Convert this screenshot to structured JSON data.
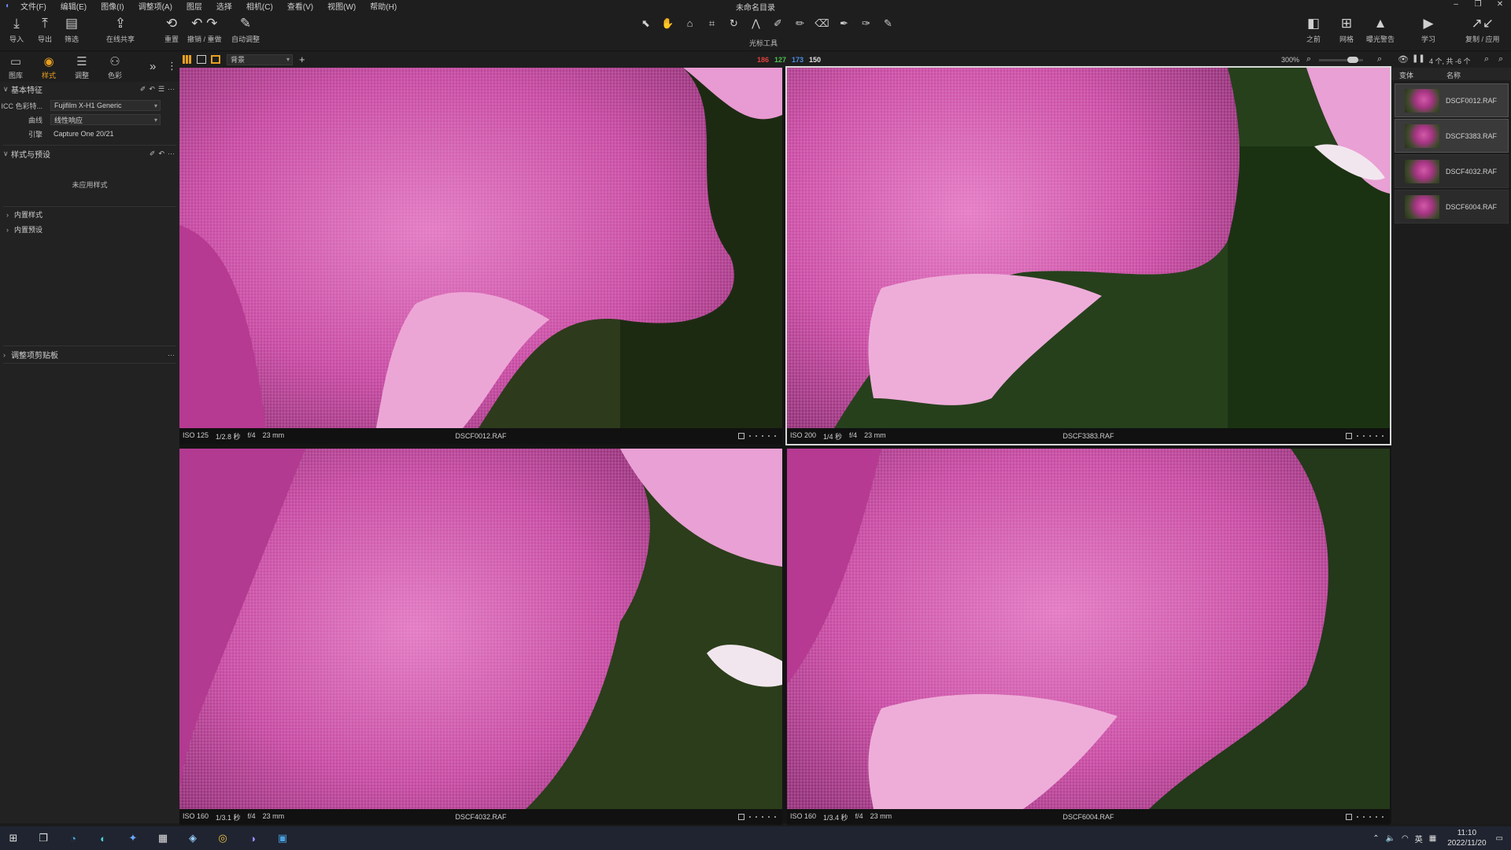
{
  "app": {
    "title": "未命名目录",
    "menu": [
      "文件(F)",
      "编辑(E)",
      "图像(I)",
      "调整项(A)",
      "图层",
      "选择",
      "相机(C)",
      "查看(V)",
      "视图(W)",
      "帮助(H)"
    ],
    "window_controls": [
      "–",
      "❐",
      "✕"
    ]
  },
  "toolbar": {
    "left": [
      {
        "label": "导入",
        "icon": "download-icon"
      },
      {
        "label": "导出",
        "icon": "upload-icon"
      },
      {
        "label": "筛选",
        "icon": "filter-icon"
      },
      {
        "label": "在线共享",
        "icon": "share-icon"
      },
      {
        "label": "重置",
        "icon": "reset-icon"
      },
      {
        "label": "撤销 / 重做",
        "icon": "undo-redo-icon"
      },
      {
        "label": "自动调整",
        "icon": "wand-icon"
      }
    ],
    "cursor_tools_label": "光标工具",
    "right": [
      {
        "label": "之前",
        "icon": "before-icon"
      },
      {
        "label": "网格",
        "icon": "grid-icon"
      },
      {
        "label": "曝光警告",
        "icon": "warning-icon"
      },
      {
        "label": "学习",
        "icon": "play-icon"
      },
      {
        "label": "复制 / 应用",
        "icon": "copy-apply-icon"
      }
    ]
  },
  "tool_tabs": [
    {
      "label": "图库",
      "icon": "library-icon",
      "active": false
    },
    {
      "label": "样式",
      "icon": "style-icon",
      "active": true
    },
    {
      "label": "调整",
      "icon": "adjust-icon",
      "active": false
    },
    {
      "label": "色彩",
      "icon": "color-icon",
      "active": false
    }
  ],
  "left_panel": {
    "basic": {
      "title": "基本特征",
      "icc_label": "ICC 色彩特...",
      "icc_value": "Fujifilm X-H1 Generic",
      "curve_label": "曲线",
      "curve_value": "线性响应",
      "engine_label": "引擎",
      "engine_value": "Capture One 20/21"
    },
    "styles": {
      "title": "样式与预设",
      "empty_text": "未应用样式",
      "builtin_styles": "内置样式",
      "builtin_presets": "内置预设"
    },
    "clipboard": {
      "title": "调整项剪贴板"
    }
  },
  "viewer_bar": {
    "dropdown": "背景",
    "rgb": {
      "r": "186",
      "g": "127",
      "b": "173",
      "l": "150"
    },
    "zoom": "300%"
  },
  "browser_bar": {
    "count": "4 个, 共 -6 个",
    "col_variant": "变体",
    "col_name": "名称"
  },
  "tiles": [
    {
      "iso": "ISO 125",
      "shutter": "1/2.8 秒",
      "aperture": "f/4",
      "focal": "23 mm",
      "file": "DSCF0012.RAF",
      "selected": false
    },
    {
      "iso": "ISO 200",
      "shutter": "1/4 秒",
      "aperture": "f/4",
      "focal": "23 mm",
      "file": "DSCF3383.RAF",
      "selected": true
    },
    {
      "iso": "ISO 160",
      "shutter": "1/3.1 秒",
      "aperture": "f/4",
      "focal": "23 mm",
      "file": "DSCF4032.RAF",
      "selected": false
    },
    {
      "iso": "ISO 160",
      "shutter": "1/3.4 秒",
      "aperture": "f/4",
      "focal": "23 mm",
      "file": "DSCF6004.RAF",
      "selected": false
    }
  ],
  "browser": [
    {
      "name": "DSCF0012.RAF",
      "selected": true
    },
    {
      "name": "DSCF3383.RAF",
      "selected": true
    },
    {
      "name": "DSCF4032.RAF",
      "selected": false
    },
    {
      "name": "DSCF6004.RAF",
      "selected": false
    }
  ],
  "taskbar": {
    "time": "11:10",
    "date": "2022/11/20",
    "ime": "英",
    "apps": [
      "start-icon",
      "task-view-icon",
      "edge-icon",
      "app-icon",
      "app-icon",
      "calculator-icon",
      "app-icon",
      "chrome-icon",
      "capture-one-icon",
      "photo-icon"
    ]
  },
  "colors": {
    "accent": "#e8a020",
    "r": "#e04040",
    "g": "#4ec04e",
    "b": "#4a8ee8"
  }
}
